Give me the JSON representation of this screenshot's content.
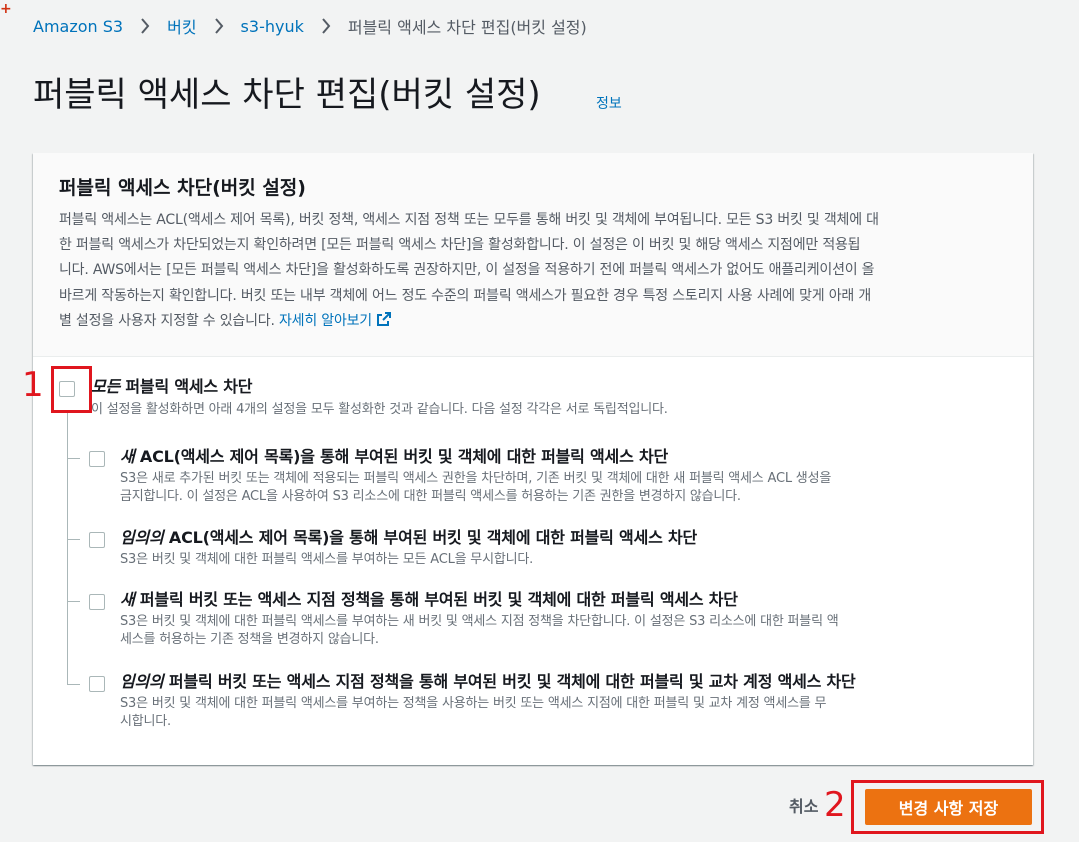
{
  "breadcrumb": {
    "items": [
      "Amazon S3",
      "버킷",
      "s3-hyuk"
    ],
    "current": "퍼블릭 액세스 차단 편집(버킷 설정)"
  },
  "page": {
    "title": "퍼블릭 액세스 차단 편집(버킷 설정)",
    "info_link": "정보"
  },
  "panel": {
    "title": "퍼블릭 액세스 차단(버킷 설정)",
    "desc_lines": [
      "퍼블릭 액세스는 ACL(액세스 제어 목록), 버킷 정책, 액세스 지점 정책 또는 모두를 통해 버킷 및 객체에 부여됩니다. 모든 S3 버킷 및 객체에 대",
      "한 퍼블릭 액세스가 차단되었는지 확인하려면 [모든 퍼블릭 액세스 차단]을 활성화합니다. 이 설정은 이 버킷 및 해당 액세스 지점에만 적용됩",
      "니다. AWS에서는 [모든 퍼블릭 액세스 차단]을 활성화하도록 권장하지만, 이 설정을 적용하기 전에 퍼블릭 액세스가 없어도 애플리케이션이 올",
      "바르게 작동하는지 확인합니다. 버킷 또는 내부 객체에 어느 정도 수준의 퍼블릭 액세스가 필요한 경우 특정 스토리지 사용 사례에 맞게 아래 개",
      "별 설정을 사용자 지정할 수 있습니다."
    ],
    "learn_more": "자세히 알아보기"
  },
  "block_all": {
    "label_em": "모든",
    "label": " 퍼블릭 액세스 차단",
    "desc": "이 설정을 활성화하면 아래 4개의 설정을 모두 활성화한 것과 같습니다. 다음 설정 각각은 서로 독립적입니다."
  },
  "options": [
    {
      "label_em": "새",
      "label": " ACL(액세스 제어 목록)을 통해 부여된 버킷 및 객체에 대한 퍼블릭 액세스 차단",
      "desc_lines": [
        "S3은 새로 추가된 버킷 또는 객체에 적용되는 퍼블릭 액세스 권한을 차단하며, 기존 버킷 및 객체에 대한 새 퍼블릭 액세스 ACL 생성을",
        "금지합니다. 이 설정은 ACL을 사용하여 S3 리소스에 대한 퍼블릭 액세스를 허용하는 기존 권한을 변경하지 않습니다."
      ]
    },
    {
      "label_em": "임의의",
      "label": " ACL(액세스 제어 목록)을 통해 부여된 버킷 및 객체에 대한 퍼블릭 액세스 차단",
      "desc_lines": [
        "S3은 버킷 및 객체에 대한 퍼블릭 액세스를 부여하는 모든 ACL을 무시합니다."
      ]
    },
    {
      "label_em": "새",
      "label": " 퍼블릭 버킷 또는 액세스 지점 정책을 통해 부여된 버킷 및 객체에 대한 퍼블릭 액세스 차단",
      "desc_lines": [
        "S3은 버킷 및 객체에 대한 퍼블릭 액세스를 부여하는 새 버킷 및 액세스 지점 정책을 차단합니다. 이 설정은 S3 리소스에 대한 퍼블릭 액",
        "세스를 허용하는 기존 정책을 변경하지 않습니다."
      ]
    },
    {
      "label_em": "임의의",
      "label": " 퍼블릭 버킷 또는 액세스 지점 정책을 통해 부여된 버킷 및 객체에 대한 퍼블릭 및 교차 계정 액세스 차단",
      "desc_lines": [
        "S3은 버킷 및 객체에 대한 퍼블릭 액세스를 부여하는 정책을 사용하는 버킷 또는 액세스 지점에 대한 퍼블릭 및 교차 계정 액세스를 무",
        "시합니다."
      ]
    }
  ],
  "footer": {
    "cancel": "취소",
    "save": "변경 사항 저장"
  },
  "annotations": {
    "plus": "+",
    "n1": "1",
    "n2": "2"
  },
  "colors": {
    "accent": "#ec7211",
    "link": "#0073bb",
    "annotation": "#e0161e"
  }
}
